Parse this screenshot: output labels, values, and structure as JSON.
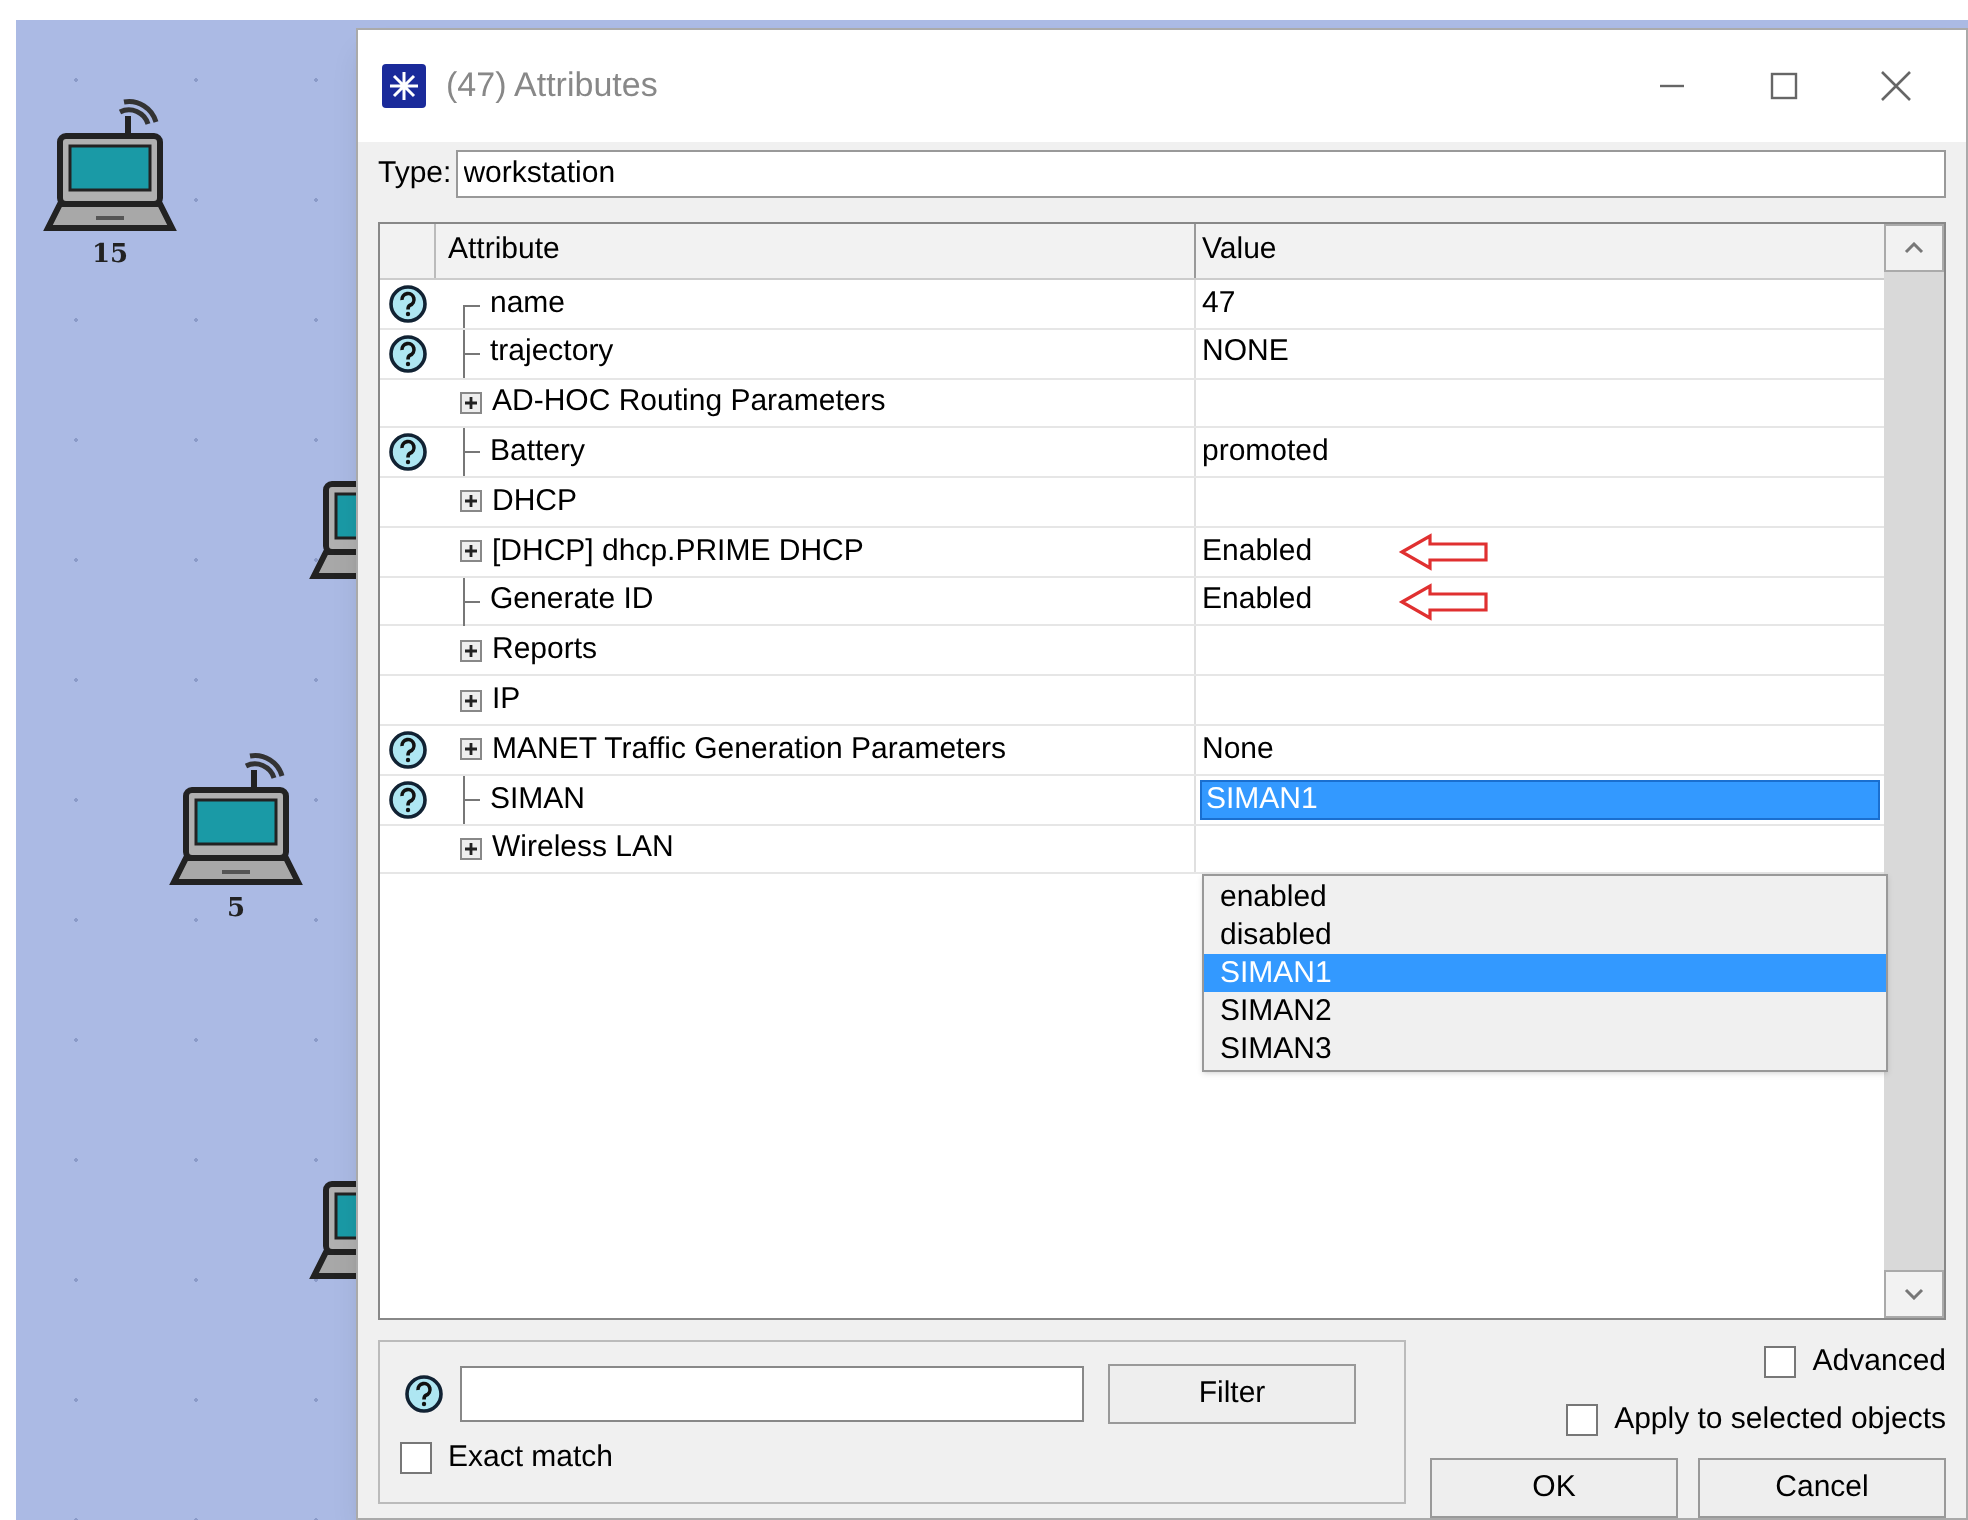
{
  "canvas": {
    "nodes": [
      {
        "label": "15"
      },
      {
        "label": "5"
      }
    ]
  },
  "window": {
    "title": "(47) Attributes"
  },
  "type_field": {
    "label": "Type:",
    "value": "workstation"
  },
  "table": {
    "columns": [
      "Attribute",
      "Value"
    ],
    "rows": [
      {
        "name": "name",
        "value": "47",
        "help": true,
        "kind": "leaf",
        "marked": false
      },
      {
        "name": "trajectory",
        "value": "NONE",
        "help": true,
        "kind": "leaf",
        "marked": false
      },
      {
        "name": "AD-HOC Routing Parameters",
        "help": false,
        "kind": "group",
        "marked": false
      },
      {
        "name": "Battery",
        "value": "promoted",
        "help": true,
        "kind": "leaf",
        "marked": false
      },
      {
        "name": "DHCP",
        "help": false,
        "kind": "group",
        "marked": false
      },
      {
        "name": "[DHCP] dhcp.PRIME DHCP",
        "value": "Enabled",
        "help": false,
        "kind": "group",
        "marked": true
      },
      {
        "name": "Generate ID",
        "value": "Enabled",
        "help": false,
        "kind": "leaf",
        "marked": true
      },
      {
        "name": "Reports",
        "help": false,
        "kind": "group",
        "marked": false
      },
      {
        "name": "IP",
        "help": false,
        "kind": "group",
        "marked": false
      },
      {
        "name": "MANET Traffic Generation Parameters",
        "value": "None",
        "help": true,
        "kind": "group",
        "marked": false
      },
      {
        "name": "SIMAN",
        "value": "SIMAN1",
        "help": true,
        "kind": "leaf",
        "marked": false,
        "editing": true
      },
      {
        "name": "Wireless LAN",
        "help": false,
        "kind": "group",
        "marked": false
      }
    ]
  },
  "dropdown": {
    "options": [
      {
        "label": "enabled",
        "selected": false
      },
      {
        "label": "disabled",
        "selected": false
      },
      {
        "label": "SIMAN1",
        "selected": true
      },
      {
        "label": "SIMAN2",
        "selected": false
      },
      {
        "label": "SIMAN3",
        "selected": false
      }
    ]
  },
  "filter": {
    "button": "Filter",
    "exact_match": {
      "label": "Exact match",
      "checked": false
    }
  },
  "options": [
    {
      "label": "Advanced",
      "checked": false
    },
    {
      "label": "Apply to selected objects",
      "checked": false
    }
  ],
  "buttons": [
    {
      "label": "OK"
    },
    {
      "label": "Cancel"
    }
  ]
}
